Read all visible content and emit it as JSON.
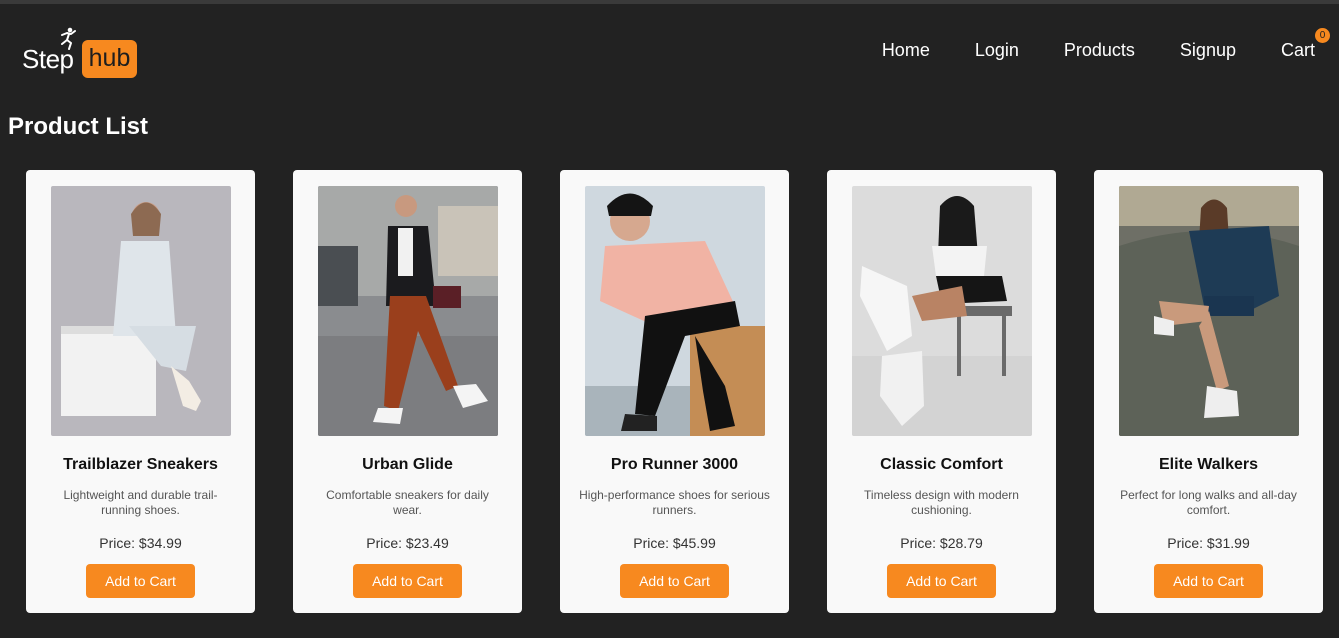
{
  "brand": {
    "step": "Step",
    "hub": "hub"
  },
  "nav": {
    "home": "Home",
    "login": "Login",
    "products": "Products",
    "signup": "Signup",
    "cart": "Cart",
    "cart_count": "0"
  },
  "page_title": "Product List",
  "products": [
    {
      "name": "Trailblazer Sneakers",
      "description": "Lightweight and durable trail-running shoes.",
      "price": "Price: $34.99",
      "button": "Add to Cart"
    },
    {
      "name": "Urban Glide",
      "description": "Comfortable sneakers for daily wear.",
      "price": "Price: $23.49",
      "button": "Add to Cart"
    },
    {
      "name": "Pro Runner 3000",
      "description": "High-performance shoes for serious runners.",
      "price": "Price: $45.99",
      "button": "Add to Cart"
    },
    {
      "name": "Classic Comfort",
      "description": "Timeless design with modern cushioning.",
      "price": "Price: $28.79",
      "button": "Add to Cart"
    },
    {
      "name": "Elite Walkers",
      "description": "Perfect for long walks and all-day comfort.",
      "price": "Price: $31.99",
      "button": "Add to Cart"
    }
  ],
  "colors": {
    "accent": "#f7891f",
    "background": "#222222",
    "card": "#f9f9f9"
  }
}
